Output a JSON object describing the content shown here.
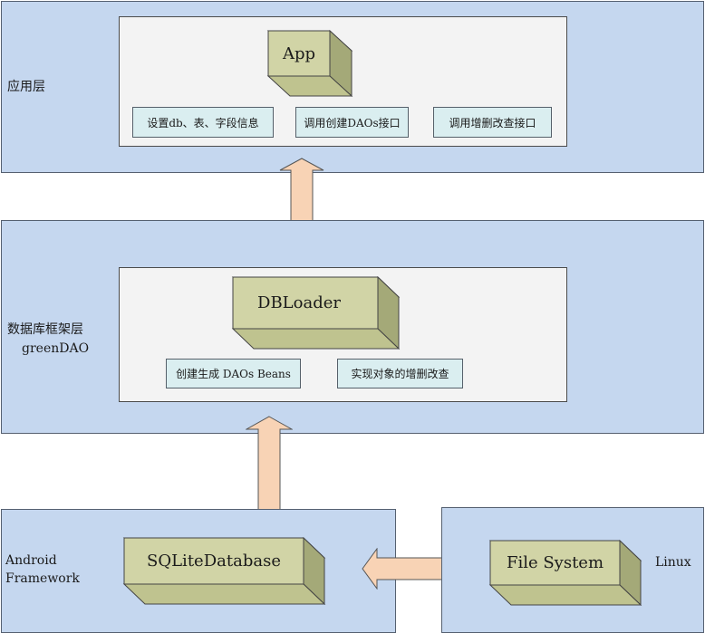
{
  "app_layer": {
    "label": "应用层",
    "app_box": "App",
    "chips": [
      "设置db、表、字段信息",
      "调用创建DAOs接口",
      "调用增删改查接口"
    ]
  },
  "framework_layer": {
    "label_line1": "数据库框架层",
    "label_line2": "greenDAO",
    "loader_box": "DBLoader",
    "chips": [
      "创建生成 DAOs Beans",
      "实现对象的增删改查"
    ]
  },
  "android_layer": {
    "label_line1": "Android",
    "label_line2": "Framework",
    "sqlite_box": "SQLiteDatabase"
  },
  "linux_layer": {
    "label": "Linux",
    "fs_box": "File System"
  },
  "colors": {
    "layer_fill": "#c5d7ef",
    "panel_fill": "#f3f3f3",
    "chip_fill": "#daeef0",
    "box_front": "#d1d4a6",
    "box_top": "#e4e6c8",
    "box_side": "#a4a978",
    "arrow_fill": "#f8d3b5"
  }
}
